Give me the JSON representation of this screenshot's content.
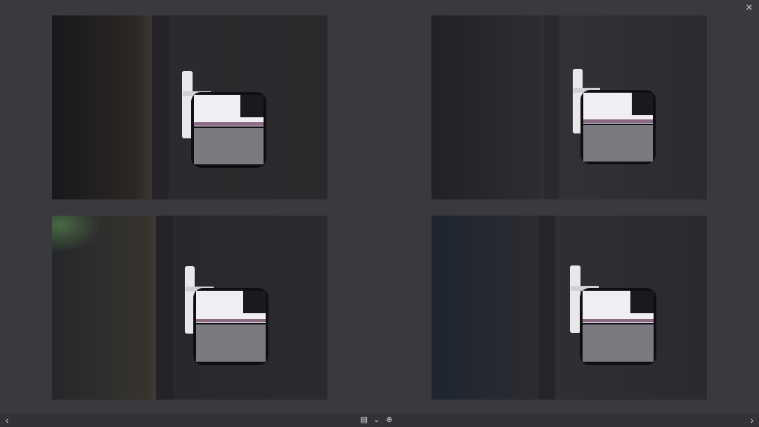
{
  "window": {
    "close_icon": "close-icon"
  },
  "photos": [
    {
      "caption": "",
      "selected": false
    },
    {
      "caption": "",
      "selected": false
    },
    {
      "caption": "",
      "selected": false
    },
    {
      "caption": "",
      "selected": true
    }
  ],
  "toolbar": {
    "icons": [
      "film-strip-icon",
      "chevron-down-icon",
      "zoom-in-icon"
    ]
  },
  "nav": {
    "prev_icon": "chevron-left-icon",
    "next_icon": "chevron-right-icon"
  },
  "colors": {
    "background": "#3a393d",
    "caption": "#8a898d",
    "caption_selected": "#e6e6e6"
  }
}
